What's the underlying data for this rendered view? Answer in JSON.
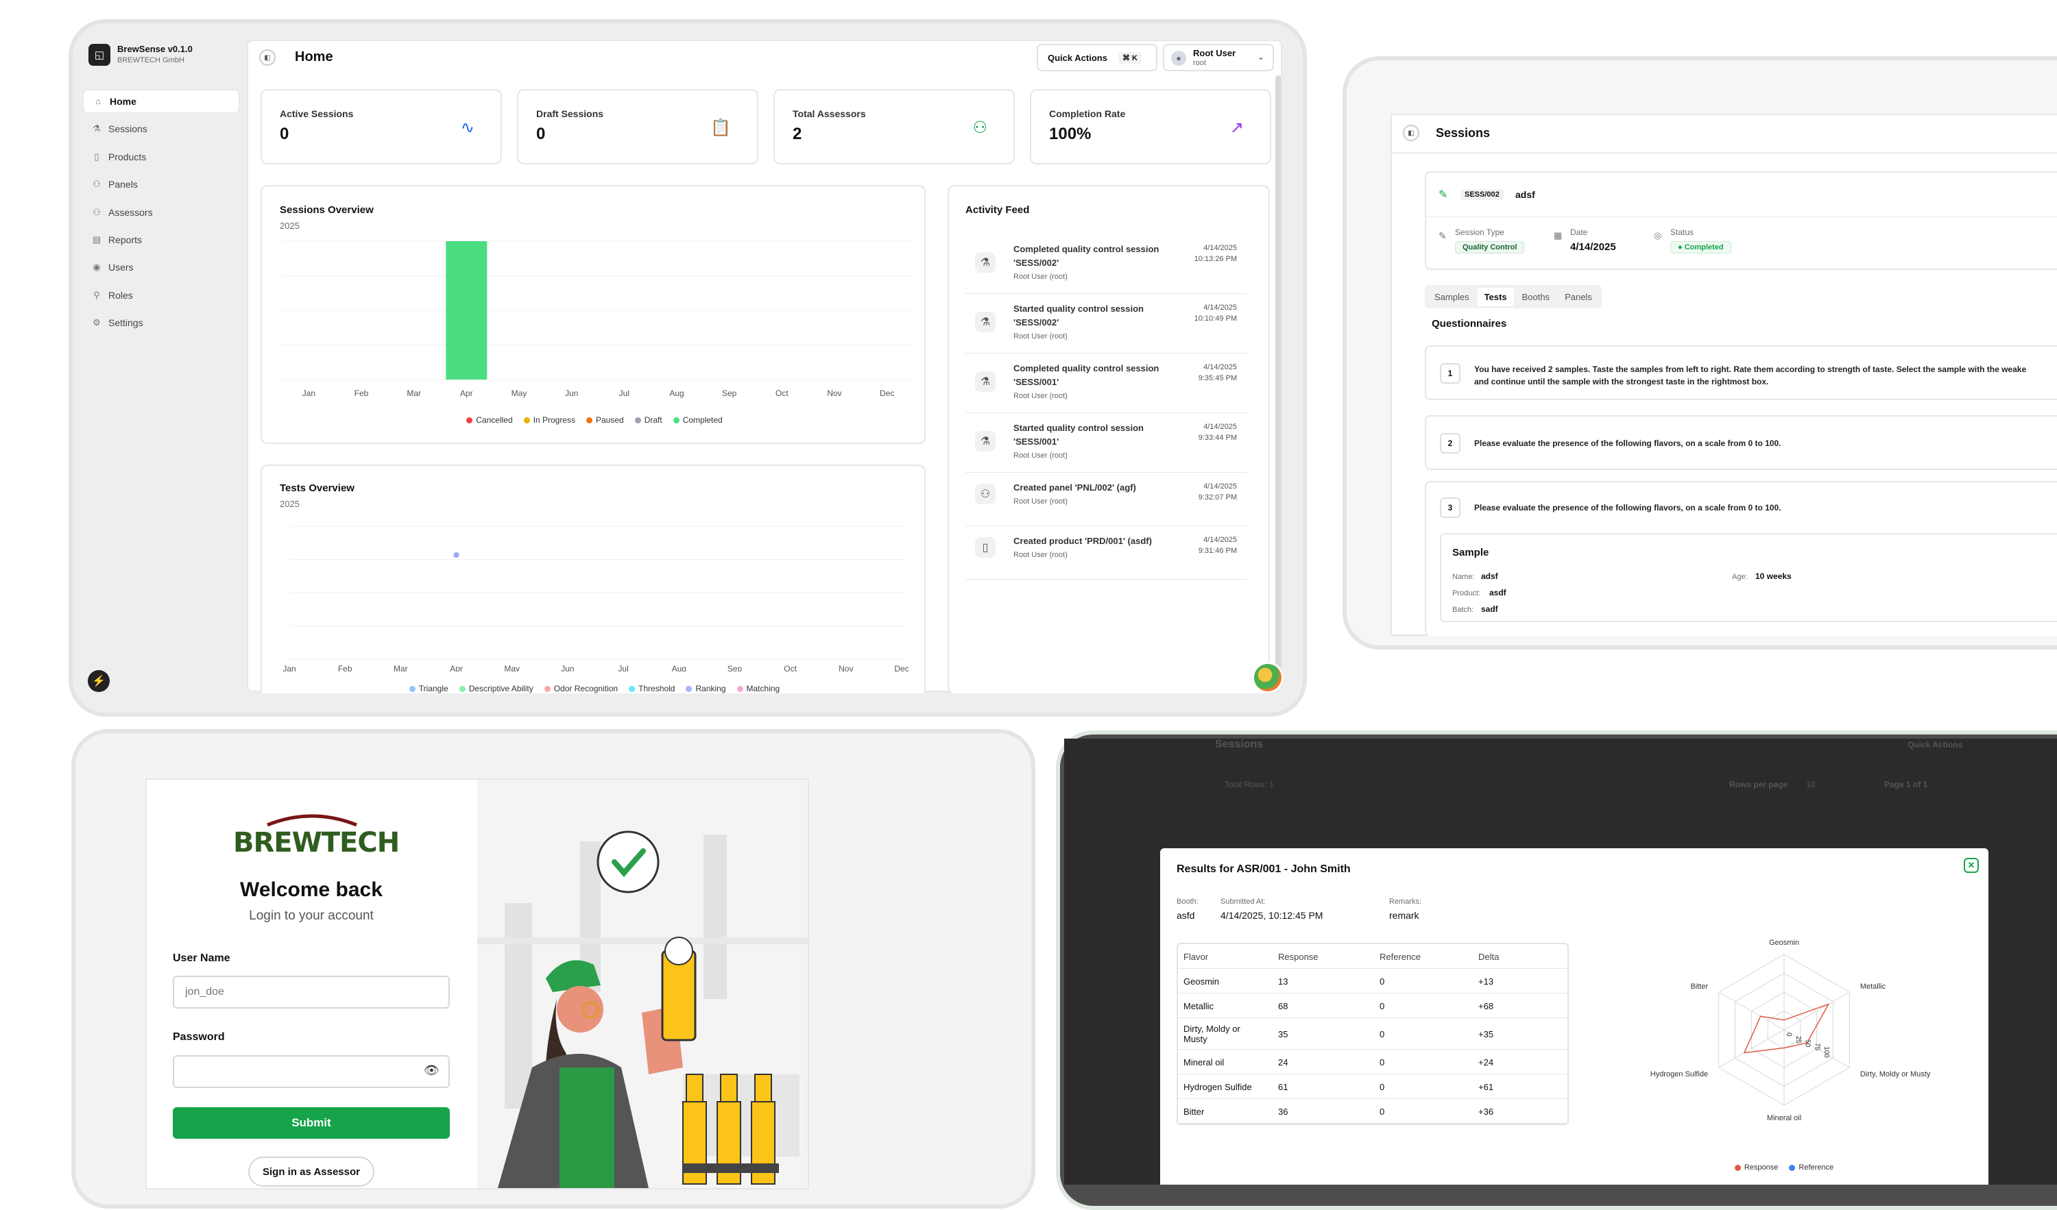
{
  "dashboard": {
    "brand": {
      "name": "BrewSense v0.1.0",
      "company": "BREWTECH GmbH"
    },
    "page_title": "Home",
    "quick_actions": {
      "label": "Quick Actions",
      "shortcut": "⌘ K"
    },
    "user": {
      "name": "Root User",
      "role": "root"
    },
    "nav": [
      "Home",
      "Sessions",
      "Products",
      "Panels",
      "Assessors",
      "Reports",
      "Users",
      "Roles",
      "Settings"
    ],
    "stats": [
      {
        "title": "Active Sessions",
        "value": "0",
        "icon": "activity-icon",
        "color": "#2563eb"
      },
      {
        "title": "Draft Sessions",
        "value": "0",
        "icon": "clipboard-icon",
        "color": "#d97706"
      },
      {
        "title": "Total Assessors",
        "value": "2",
        "icon": "users-icon",
        "color": "#16a34a"
      },
      {
        "title": "Completion Rate",
        "value": "100%",
        "icon": "trending-up-icon",
        "color": "#9333ea"
      }
    ],
    "sessions_overview": {
      "title": "Sessions Overview",
      "year": "2025",
      "legend": [
        "Cancelled",
        "In Progress",
        "Paused",
        "Draft",
        "Completed"
      ]
    },
    "tests_overview": {
      "title": "Tests Overview",
      "year": "2025",
      "legend": [
        "Triangle",
        "Descriptive Ability",
        "Odor Recognition",
        "Threshold",
        "Ranking",
        "Matching"
      ]
    },
    "activity_feed": {
      "title": "Activity Feed",
      "items": [
        {
          "title": "Completed quality control session 'SESS/002'",
          "user": "Root User (root)",
          "date": "4/14/2025",
          "time": "10:13:26 PM",
          "icon": "flask-icon"
        },
        {
          "title": "Started quality control session 'SESS/002'",
          "user": "Root User (root)",
          "date": "4/14/2025",
          "time": "10:10:49 PM",
          "icon": "flask-icon"
        },
        {
          "title": "Completed quality control session 'SESS/001'",
          "user": "Root User (root)",
          "date": "4/14/2025",
          "time": "9:35:45 PM",
          "icon": "flask-icon"
        },
        {
          "title": "Started quality control session 'SESS/001'",
          "user": "Root User (root)",
          "date": "4/14/2025",
          "time": "9:33:44 PM",
          "icon": "flask-icon"
        },
        {
          "title": "Created panel 'PNL/002' (agf)",
          "user": "Root User (root)",
          "date": "4/14/2025",
          "time": "9:32:07 PM",
          "icon": "users-icon"
        },
        {
          "title": "Created product 'PRD/001' (asdf)",
          "user": "Root User (root)",
          "date": "4/14/2025",
          "time": "9:31:46 PM",
          "icon": "cup-icon"
        }
      ]
    }
  },
  "session_detail": {
    "page_title": "Sessions",
    "code": "SESS/002",
    "name": "adsf",
    "session_type_label": "Session Type",
    "session_type": "Quality Control",
    "date_label": "Date",
    "date": "4/14/2025",
    "status_label": "Status",
    "status": "Completed",
    "tabs": [
      "Samples",
      "Tests",
      "Booths",
      "Panels"
    ],
    "section_title": "Questionnaires",
    "questions": [
      {
        "num": "1",
        "text": "You have received 2 samples. Taste the samples from left to right. Rate them according to strength of taste. Select the sample with the weake",
        "text2": "and continue until the sample with the strongest taste in the rightmost box."
      },
      {
        "num": "2",
        "text": "Please evaluate the presence of the following flavors, on a scale from 0 to 100."
      },
      {
        "num": "3",
        "text": "Please evaluate the presence of the following flavors, on a scale from 0 to 100."
      }
    ],
    "sample": {
      "title": "Sample",
      "name_label": "Name:",
      "name": "adsf",
      "age_label": "Age:",
      "age": "10 weeks",
      "product_label": "Product:",
      "product": "asdf",
      "batch_label": "Batch:",
      "batch": "sadf"
    }
  },
  "login": {
    "logo": "BREWTECH",
    "heading": "Welcome back",
    "subheading": "Login to your account",
    "username_label": "User Name",
    "username_placeholder": "jon_doe",
    "password_label": "Password",
    "submit": "Submit",
    "assessor_button": "Sign in as Assessor"
  },
  "results_modal": {
    "title": "Results for ASR/001 - John Smith",
    "booth_label": "Booth:",
    "booth": "asfd",
    "submitted_label": "Submitted At:",
    "submitted": "4/14/2025, 10:12:45 PM",
    "remarks_label": "Remarks:",
    "remarks": "remark",
    "columns": [
      "Flavor",
      "Response",
      "Reference",
      "Delta"
    ],
    "rows": [
      [
        "Geosmin",
        "13",
        "0",
        "+13"
      ],
      [
        "Metallic",
        "68",
        "0",
        "+68"
      ],
      [
        "Dirty, Moldy or Musty",
        "35",
        "0",
        "+35"
      ],
      [
        "Mineral oil",
        "24",
        "0",
        "+24"
      ],
      [
        "Hydrogen Sulfide",
        "61",
        "0",
        "+61"
      ],
      [
        "Bitter",
        "36",
        "0",
        "+36"
      ]
    ],
    "radar_axes": [
      "Geosmin",
      "Metallic",
      "Dirty, Moldy or Musty",
      "Mineral oil",
      "Hydrogen Sulfide",
      "Bitter"
    ],
    "radar_ticks": [
      "0",
      "25",
      "50",
      "75",
      "100"
    ],
    "legend": [
      "Response",
      "Reference"
    ],
    "background": {
      "title": "Sessions",
      "quick_actions": "Quick Actions",
      "total_rows": "Total Rows: 1",
      "rows_per_page": "Rows per page",
      "rows_value": "10",
      "page": "Page 1 of 1"
    }
  },
  "chart_data": [
    {
      "type": "bar",
      "title": "Sessions Overview",
      "subtitle": "2025",
      "categories": [
        "Jan",
        "Feb",
        "Mar",
        "Apr",
        "May",
        "Jun",
        "Jul",
        "Aug",
        "Sep",
        "Oct",
        "Nov",
        "Dec"
      ],
      "series": [
        {
          "name": "Cancelled",
          "color": "#ef4444",
          "values": [
            0,
            0,
            0,
            0,
            0,
            0,
            0,
            0,
            0,
            0,
            0,
            0
          ]
        },
        {
          "name": "In Progress",
          "color": "#eab308",
          "values": [
            0,
            0,
            0,
            0,
            0,
            0,
            0,
            0,
            0,
            0,
            0,
            0
          ]
        },
        {
          "name": "Paused",
          "color": "#f97316",
          "values": [
            0,
            0,
            0,
            0,
            0,
            0,
            0,
            0,
            0,
            0,
            0,
            0
          ]
        },
        {
          "name": "Draft",
          "color": "#9ca3af",
          "values": [
            0,
            0,
            0,
            0,
            0,
            0,
            0,
            0,
            0,
            0,
            0,
            0
          ]
        },
        {
          "name": "Completed",
          "color": "#4ade80",
          "values": [
            0,
            0,
            0,
            2,
            0,
            0,
            0,
            0,
            0,
            0,
            0,
            0
          ]
        }
      ],
      "ylim": [
        0,
        2
      ]
    },
    {
      "type": "line",
      "title": "Tests Overview",
      "subtitle": "2025",
      "categories": [
        "Jan",
        "Feb",
        "Mar",
        "Apr",
        "May",
        "Jun",
        "Jul",
        "Aug",
        "Sep",
        "Oct",
        "Nov",
        "Dec"
      ],
      "series": [
        {
          "name": "Triangle",
          "color": "#93c5fd",
          "values": [
            0,
            0,
            0,
            0,
            0,
            0,
            0,
            0,
            0,
            0,
            0,
            0
          ]
        },
        {
          "name": "Descriptive Ability",
          "color": "#86efac",
          "values": [
            0,
            0,
            0,
            2,
            0,
            0,
            0,
            0,
            0,
            0,
            0,
            0
          ]
        },
        {
          "name": "Odor Recognition",
          "color": "#fca5a5",
          "values": [
            0,
            0,
            0,
            0,
            0,
            0,
            0,
            0,
            0,
            0,
            0,
            0
          ]
        },
        {
          "name": "Threshold",
          "color": "#67e8f9",
          "values": [
            0,
            0,
            0,
            0,
            0,
            0,
            0,
            0,
            0,
            0,
            0,
            0
          ]
        },
        {
          "name": "Ranking",
          "color": "#a5b4fc",
          "values": [
            0,
            0,
            0,
            0,
            0,
            0,
            0,
            0,
            0,
            0,
            0,
            0
          ]
        },
        {
          "name": "Matching",
          "color": "#f9a8d4",
          "values": [
            0,
            0,
            0,
            0,
            0,
            0,
            0,
            0,
            0,
            0,
            0,
            0
          ]
        }
      ]
    },
    {
      "type": "radar",
      "axes": [
        "Geosmin",
        "Metallic",
        "Dirty, Moldy or Musty",
        "Mineral oil",
        "Hydrogen Sulfide",
        "Bitter"
      ],
      "series": [
        {
          "name": "Response",
          "color": "#e05a47",
          "values": [
            13,
            68,
            35,
            24,
            61,
            36
          ]
        },
        {
          "name": "Reference",
          "color": "#3b82f6",
          "values": [
            0,
            0,
            0,
            0,
            0,
            0
          ]
        }
      ],
      "rlim": [
        0,
        100
      ]
    }
  ]
}
